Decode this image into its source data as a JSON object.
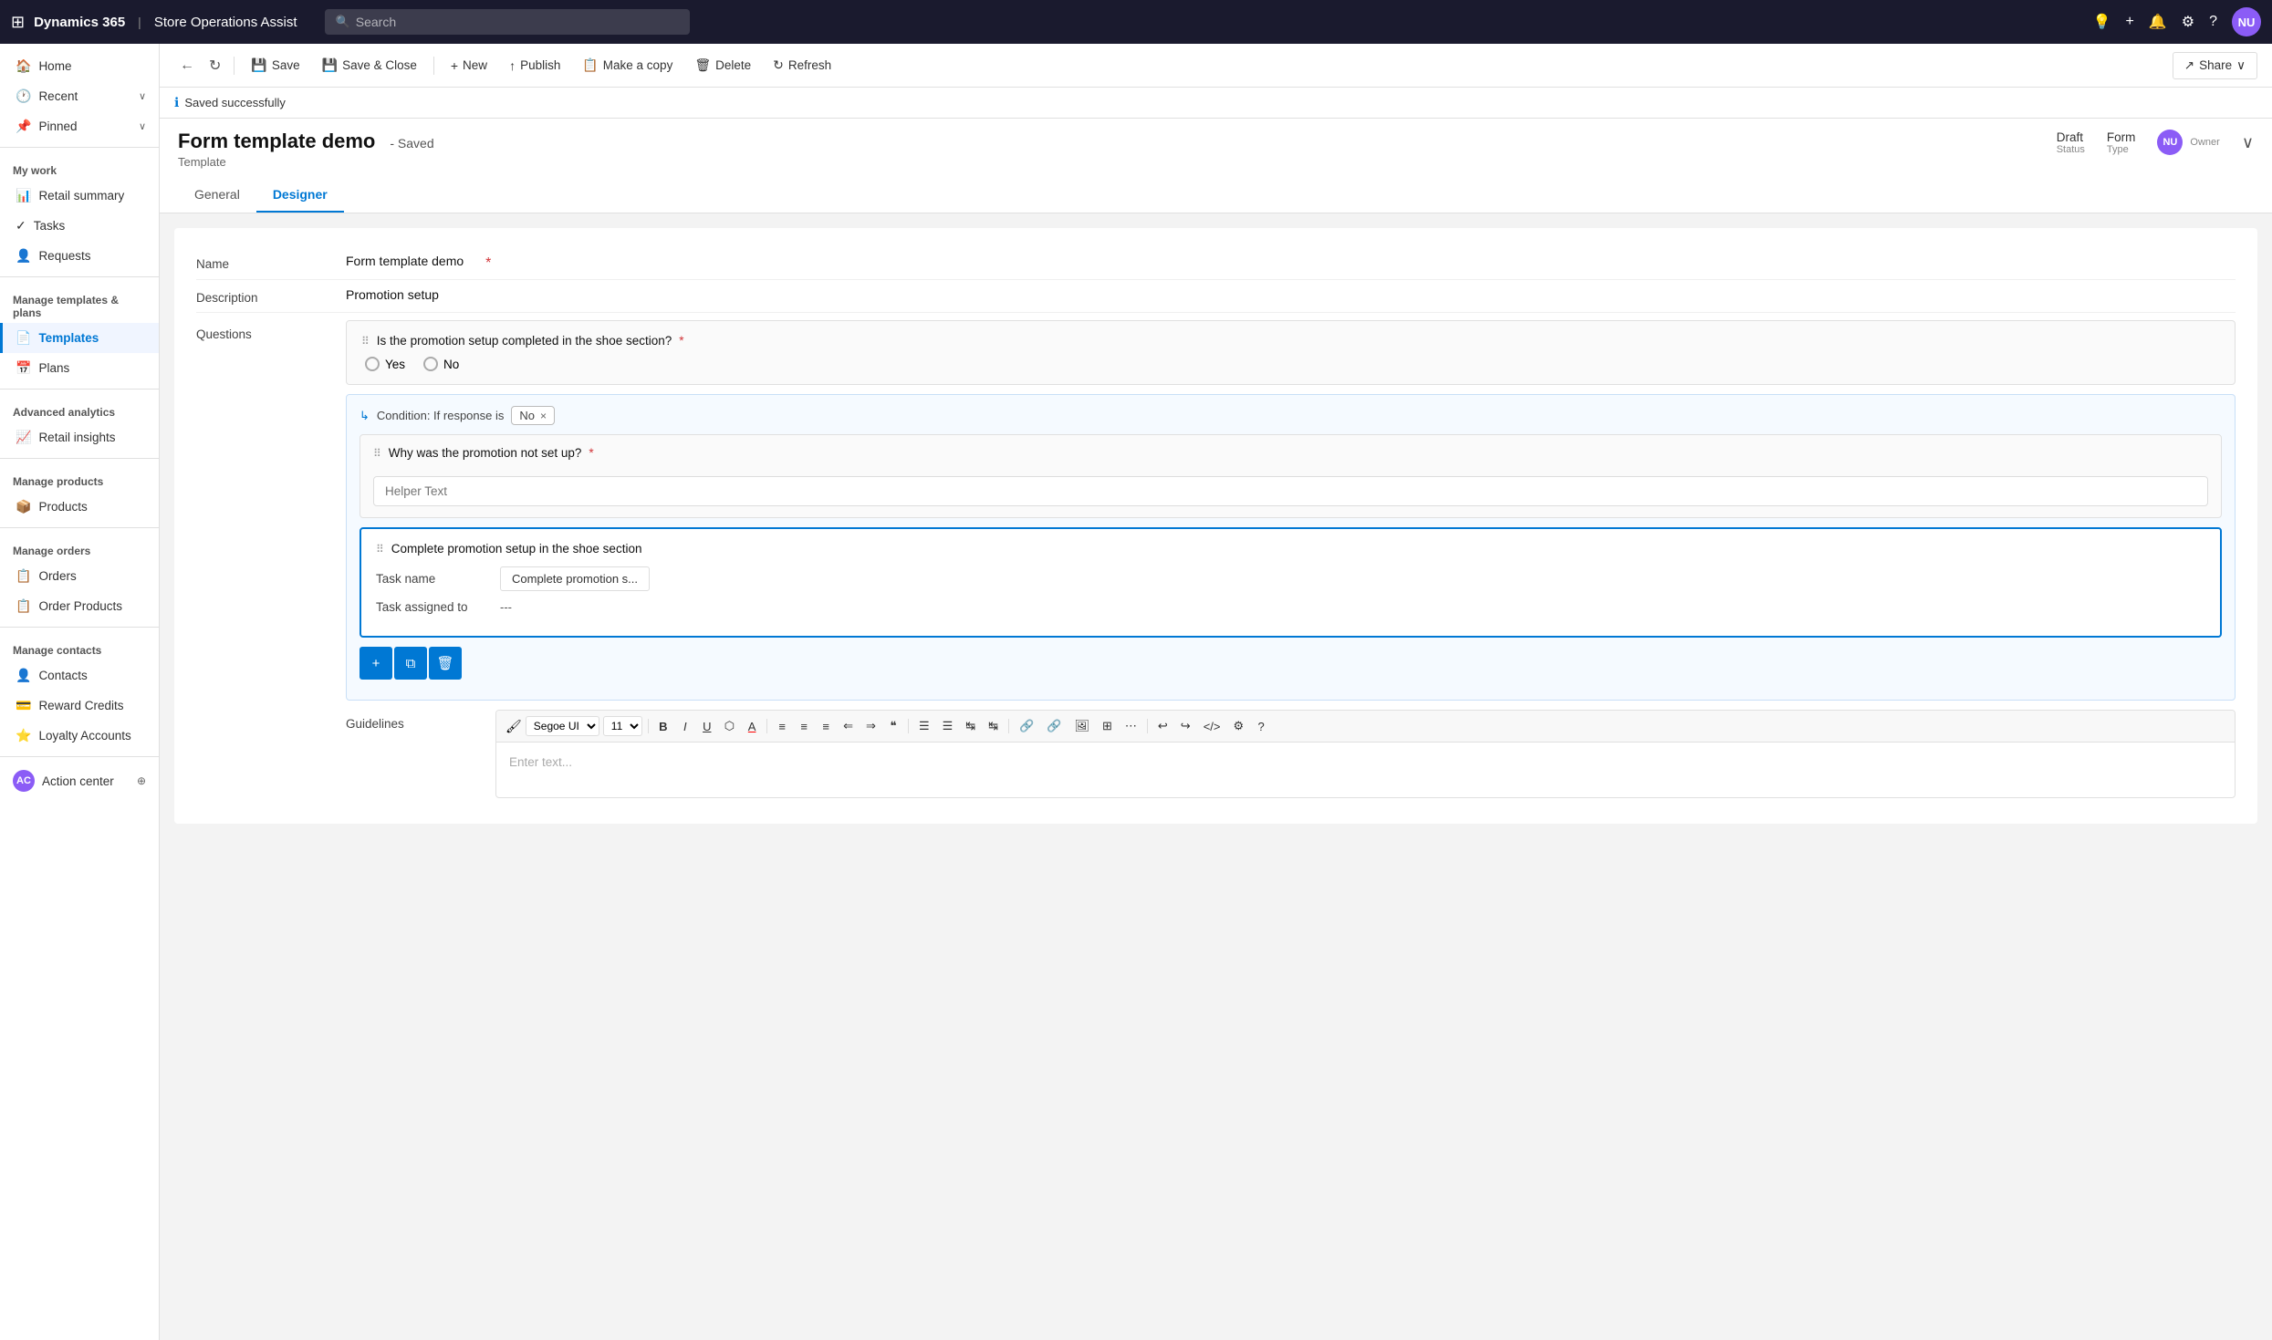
{
  "topbar": {
    "apps_icon": "⊞",
    "product": "Dynamics 365",
    "separator": "|",
    "app_name": "Store Operations Assist",
    "search_placeholder": "Search",
    "icons": [
      "🔔",
      "+",
      "🔔",
      "⚙",
      "?"
    ],
    "avatar_text": "NU"
  },
  "cmdbar": {
    "back_icon": "←",
    "refresh_icon": "↻",
    "save_label": "Save",
    "save_icon": "💾",
    "save_close_label": "Save & Close",
    "save_close_icon": "💾",
    "new_label": "New",
    "new_icon": "+",
    "publish_label": "Publish",
    "publish_icon": "↑",
    "copy_label": "Make a copy",
    "copy_icon": "📋",
    "delete_label": "Delete",
    "delete_icon": "🗑",
    "refresh_label": "Refresh",
    "share_label": "Share",
    "share_icon": "↗"
  },
  "saved_banner": {
    "icon": "ℹ",
    "text": "Saved successfully"
  },
  "form_header": {
    "title": "Form template demo",
    "saved_label": "- Saved",
    "subtitle": "Template",
    "status_label": "Status",
    "status_value": "Draft",
    "type_label": "Type",
    "type_value": "Form",
    "owner_label": "Owner",
    "owner_avatar": "NU",
    "collapse_icon": "∨"
  },
  "tabs": [
    {
      "id": "general",
      "label": "General"
    },
    {
      "id": "designer",
      "label": "Designer"
    }
  ],
  "active_tab": "designer",
  "form_fields": {
    "name_label": "Name",
    "name_value": "Form template demo",
    "description_label": "Description",
    "description_value": "Promotion setup",
    "questions_label": "Questions"
  },
  "question": {
    "drag_icon": "⠿",
    "text": "Is the promotion setup completed in the shoe section?",
    "required_star": "*",
    "yes_label": "Yes",
    "no_label": "No",
    "condition_arrow": "↳",
    "condition_text": "Condition: If response is",
    "condition_value": "No",
    "condition_x": "×",
    "sub_question_drag": "⠿",
    "sub_question_text": "Why was the promotion not set up?",
    "sub_required": "*",
    "helper_placeholder": "Helper Text",
    "task_drag": "⠿",
    "task_text": "Complete promotion setup in the shoe section",
    "task_name_label": "Task name",
    "task_name_value": "Complete promotion s...",
    "task_assigned_label": "Task assigned to",
    "task_assigned_value": "---",
    "action_add": "+",
    "action_copy": "⧉",
    "action_delete": "🗑"
  },
  "guidelines": {
    "label": "Guidelines",
    "placeholder": "Enter text...",
    "toolbar": {
      "font": "Segoe UI",
      "size": "11",
      "bold": "B",
      "italic": "I",
      "underline": "U",
      "highlight": "⊘",
      "color": "A",
      "align_left": "≡",
      "align_center": "≡",
      "align_right": "≡",
      "outdent": "⇐",
      "indent": "⇒",
      "quote": "❝",
      "bullet": "≡",
      "num_list": "≡",
      "ltr": "↹",
      "rtl": "↹",
      "link": "🔗",
      "unlink": "🔗",
      "image": "🖼",
      "table": "⊞",
      "more": "…",
      "settings": "⚙",
      "help": "?"
    }
  },
  "sidebar": {
    "hamburger": "☰",
    "nav_items": [
      {
        "id": "home",
        "icon": "🏠",
        "label": "Home"
      },
      {
        "id": "recent",
        "icon": "🕐",
        "label": "Recent",
        "chevron": "∨"
      },
      {
        "id": "pinned",
        "icon": "📌",
        "label": "Pinned",
        "chevron": "∨"
      }
    ],
    "my_work_label": "My work",
    "my_work_items": [
      {
        "id": "retail-summary",
        "icon": "📊",
        "label": "Retail summary"
      },
      {
        "id": "tasks",
        "icon": "✓",
        "label": "Tasks"
      },
      {
        "id": "requests",
        "icon": "👤",
        "label": "Requests"
      }
    ],
    "manage_templates_label": "Manage templates & plans",
    "manage_templates_items": [
      {
        "id": "templates",
        "icon": "📄",
        "label": "Templates",
        "active": true
      },
      {
        "id": "plans",
        "icon": "📅",
        "label": "Plans"
      }
    ],
    "advanced_analytics_label": "Advanced analytics",
    "advanced_items": [
      {
        "id": "retail-insights",
        "icon": "📈",
        "label": "Retail insights"
      }
    ],
    "manage_products_label": "Manage products",
    "manage_products_items": [
      {
        "id": "products",
        "icon": "📦",
        "label": "Products"
      }
    ],
    "manage_orders_label": "Manage orders",
    "manage_orders_items": [
      {
        "id": "orders",
        "icon": "📋",
        "label": "Orders"
      },
      {
        "id": "order-products",
        "icon": "📋",
        "label": "Order Products"
      }
    ],
    "manage_contacts_label": "Manage contacts",
    "manage_contacts_items": [
      {
        "id": "contacts",
        "icon": "👤",
        "label": "Contacts"
      },
      {
        "id": "reward-credits",
        "icon": "💳",
        "label": "Reward Credits"
      },
      {
        "id": "loyalty-accounts",
        "icon": "⭐",
        "label": "Loyalty Accounts"
      }
    ],
    "bottom_items": [
      {
        "id": "action-center",
        "icon": "AC",
        "label": "Action center",
        "pin": "⊕"
      }
    ]
  }
}
